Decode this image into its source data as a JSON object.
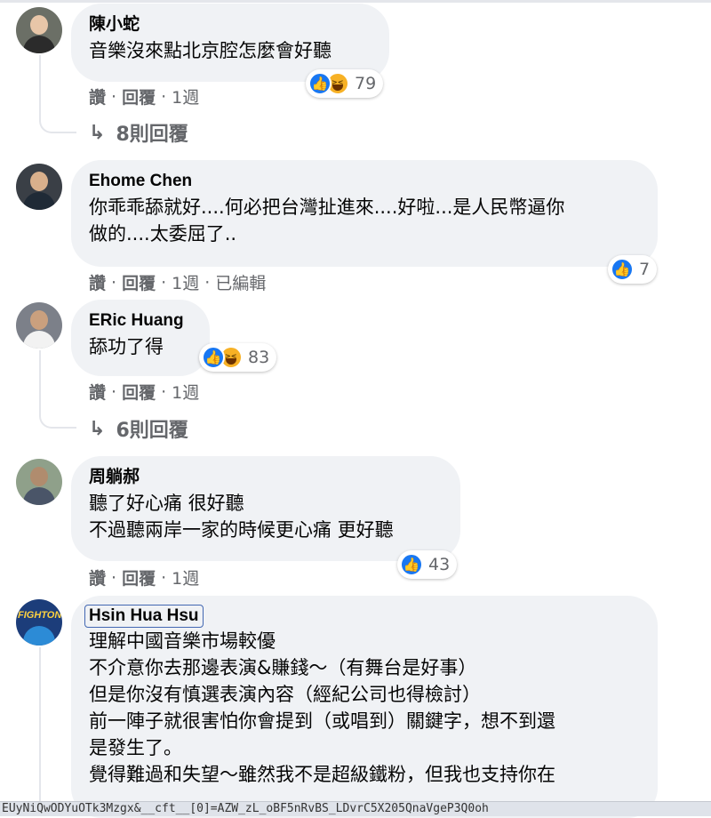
{
  "comments": [
    {
      "name": "陳小蛇",
      "text": "音樂沒來點北京腔怎麼會好聽",
      "reactions": {
        "types": [
          "like",
          "haha"
        ],
        "count": "79"
      },
      "actions": {
        "like": "讚",
        "reply": "回覆",
        "time": "1週"
      },
      "replies_label": "8則回覆"
    },
    {
      "name": "Ehome Chen",
      "text": "你乖乖舔就好....何必把台灣扯進來....好啦...是人民幣逼你\n做的....太委屈了..",
      "reactions": {
        "types": [
          "like"
        ],
        "count": "7"
      },
      "actions": {
        "like": "讚",
        "reply": "回覆",
        "time": "1週",
        "edited": "已編輯"
      }
    },
    {
      "name": "ERic Huang",
      "text": "舔功了得",
      "reactions": {
        "types": [
          "like",
          "haha"
        ],
        "count": "83"
      },
      "actions": {
        "like": "讚",
        "reply": "回覆",
        "time": "1週"
      },
      "replies_label": "6則回覆"
    },
    {
      "name": "周躺郝",
      "text": "聽了好心痛 很好聽\n不過聽兩岸一家的時候更心痛 更好聽",
      "reactions": {
        "types": [
          "like"
        ],
        "count": "43"
      },
      "actions": {
        "like": "讚",
        "reply": "回覆",
        "time": "1週"
      }
    },
    {
      "name": "Hsin Hua Hsu",
      "text": "理解中國音樂市場較優\n不介意你去那邊表演&賺錢～（有舞台是好事）\n但是你沒有慎選表演內容（經紀公司也得檢討）\n前一陣子就很害怕你會提到（或唱到）關鍵字，想不到還\n是發生了。\n覺得難過和失望～雖然我不是超級鐵粉，但我也支持你在",
      "avatar_text": "FIGHTON"
    }
  ],
  "status_bar": "EUyNiQwODYuOTk3Mzgx&__cft__[0]=AZW_zL_oBF5nRvBS_LDvrC5X205QnaVgeP3Q0oh",
  "colors": {
    "bubble": "#f0f2f5",
    "meta": "#65676b",
    "like_blue": "#1877f2",
    "haha_yellow": "#f7b125"
  }
}
